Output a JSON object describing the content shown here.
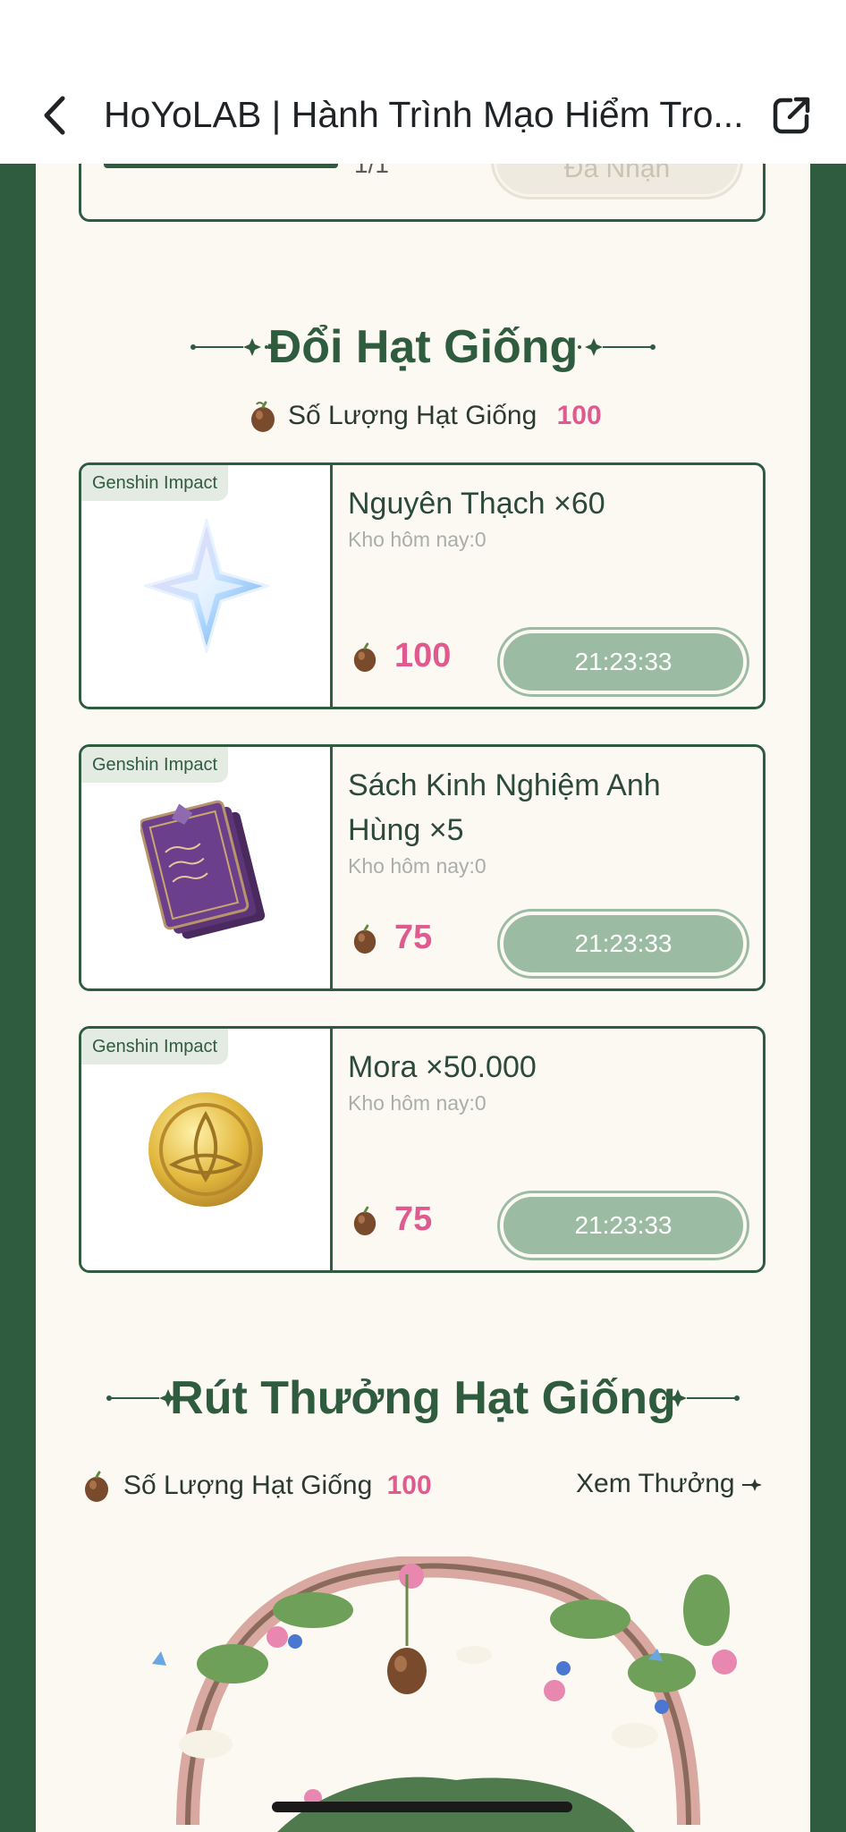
{
  "nav": {
    "title": "HoYoLAB | Hành Trình Mạo Hiểm Tro...",
    "back_icon": "chevron-left-icon",
    "share_icon": "external-share-icon"
  },
  "previous_task": {
    "progress": "1/1",
    "button_label": "Đã Nhận"
  },
  "exchange": {
    "title": "Đổi Hạt Giống",
    "seed_label": "Số Lượng Hạt Giống",
    "seed_count": "100",
    "items": [
      {
        "game": "Genshin Impact",
        "name": "Nguyên Thạch ×60",
        "stock": "Kho hôm nay:0",
        "cost": "100",
        "timer": "21:23:33",
        "icon": "primogem-icon"
      },
      {
        "game": "Genshin Impact",
        "name": "Sách Kinh Nghiệm Anh Hùng ×5",
        "stock": "Kho hôm nay:0",
        "cost": "75",
        "timer": "21:23:33",
        "icon": "heros-wit-book-icon"
      },
      {
        "game": "Genshin Impact",
        "name": "Mora ×50.000",
        "stock": "Kho hôm nay:0",
        "cost": "75",
        "timer": "21:23:33",
        "icon": "mora-coin-icon"
      }
    ]
  },
  "draw": {
    "title": "Rút Thưởng Hạt Giống",
    "seed_label": "Số Lượng Hạt Giống",
    "seed_count": "100",
    "view_rewards": "Xem Thưởng"
  },
  "colors": {
    "primary_green": "#2f5c3e",
    "accent_pink": "#e05a8f",
    "disabled_button": "#9bbba3",
    "background": "#fcf9f2"
  }
}
